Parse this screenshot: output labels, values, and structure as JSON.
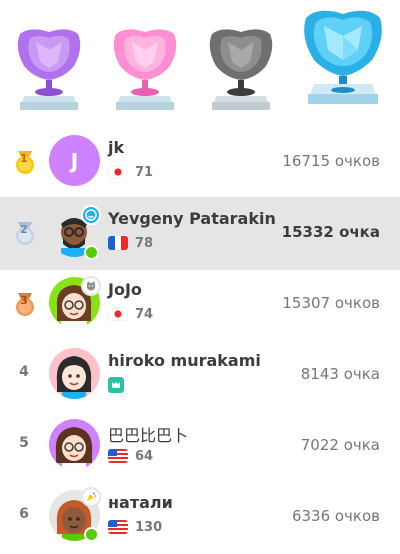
{
  "leaderboard": {
    "trophies": [
      {
        "name": "amethyst-league-trophy",
        "color": "#a560e8"
      },
      {
        "name": "pearl-league-trophy",
        "color": "#ff86d0"
      },
      {
        "name": "obsidian-league-trophy",
        "color": "#6f6f6f"
      },
      {
        "name": "diamond-league-trophy",
        "color": "#49c0f8"
      }
    ],
    "rows": [
      {
        "rank": "1",
        "rank_icon": "gold-medal-icon",
        "name": "jk",
        "avatar_letter": "J",
        "flag": "japan-flag",
        "count": "71",
        "xp": "16715 очков"
      },
      {
        "rank": "2",
        "rank_icon": "silver-medal-icon",
        "name": "Yevgeny Patarakin",
        "flag": "france-flag",
        "count": "78",
        "xp": "15332 очка"
      },
      {
        "rank": "3",
        "rank_icon": "bronze-medal-icon",
        "name": "JoJo",
        "flag": "japan-flag",
        "count": "74",
        "xp": "15307 очков"
      },
      {
        "rank": "4",
        "name": "hiroko murakami",
        "flag": "course-icon",
        "count": "",
        "xp": "8143 очка"
      },
      {
        "rank": "5",
        "name": "巴巴比巴卜",
        "flag": "usa-flag",
        "count": "64",
        "xp": "7022 очка"
      },
      {
        "rank": "6",
        "name": "натали",
        "flag": "usa-flag",
        "count": "130",
        "xp": "6336 очков"
      }
    ]
  }
}
